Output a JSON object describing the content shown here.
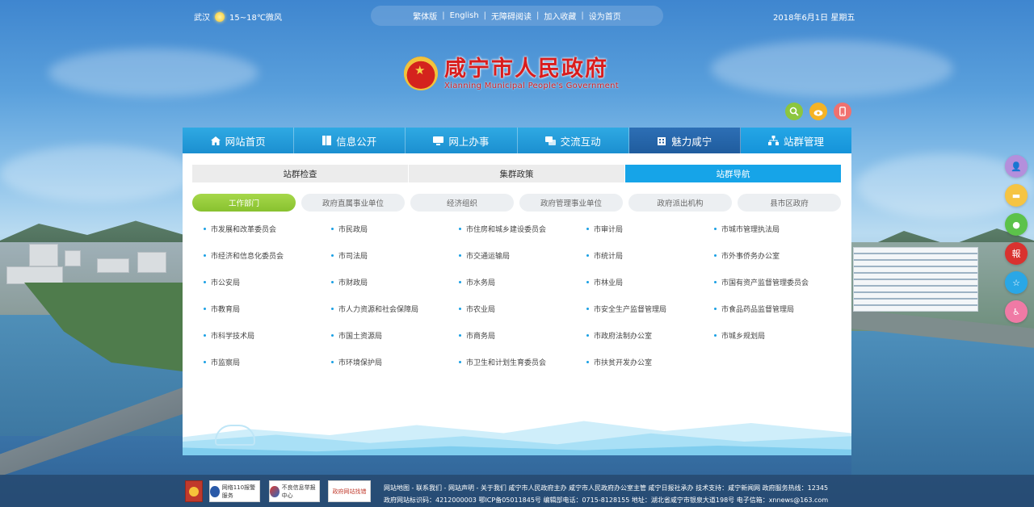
{
  "weather": {
    "city": "武汉",
    "text": "15~18℃微风",
    "icon": "sun-icon"
  },
  "topnav": {
    "items": [
      "繁体版",
      "English",
      "无障碍阅读",
      "加入收藏",
      "设为首页"
    ]
  },
  "date": "2018年6月1日 星期五",
  "logo": {
    "cn": "咸宁市人民政府",
    "en": "Xianning Municipal People's Government"
  },
  "tool_icons": [
    "search-icon",
    "weibo-icon",
    "mobile-icon"
  ],
  "mainnav": [
    {
      "label": "网站首页",
      "icon": "home-icon"
    },
    {
      "label": "信息公开",
      "icon": "book-icon"
    },
    {
      "label": "网上办事",
      "icon": "monitor-icon"
    },
    {
      "label": "交流互动",
      "icon": "chat-icon"
    },
    {
      "label": "魅力咸宁",
      "icon": "building-icon"
    },
    {
      "label": "站群管理",
      "icon": "sitemap-icon"
    }
  ],
  "tabs": [
    "站群检查",
    "集群政策",
    "站群导航"
  ],
  "active_tab": 2,
  "pills": [
    "工作部门",
    "政府直属事业单位",
    "经济组织",
    "政府管理事业单位",
    "政府派出机构",
    "县市区政府"
  ],
  "active_pill": 0,
  "links": [
    "市发展和改革委员会",
    "市民政局",
    "市住房和城乡建设委员会",
    "市审计局",
    "市城市管理执法局",
    "市经济和信息化委员会",
    "市司法局",
    "市交通运输局",
    "市统计局",
    "市外事侨务办公室",
    "市公安局",
    "市财政局",
    "市水务局",
    "市林业局",
    "市国有资产监督管理委员会",
    "市教育局",
    "市人力资源和社会保障局",
    "市农业局",
    "市安全生产监督管理局",
    "市食品药品监督管理局",
    "市科学技术局",
    "市国土资源局",
    "市商务局",
    "市政府法制办公室",
    "市城乡规划局",
    "市监察局",
    "市环境保护局",
    "市卫生和计划生育委员会",
    "市扶贫开发办公室"
  ],
  "side_buttons": [
    {
      "icon": "user-icon",
      "color": "#b48fdc"
    },
    {
      "icon": "message-icon",
      "color": "#f5c443"
    },
    {
      "icon": "wechat-icon",
      "color": "#5cc24a"
    },
    {
      "icon": "newspaper-icon",
      "color": "#d9322f"
    },
    {
      "icon": "star-icon",
      "color": "#2aa7e6"
    },
    {
      "icon": "wheelchair-icon",
      "color": "#f07aa5"
    }
  ],
  "footer": {
    "badges": [
      "网络110报警服务",
      "不良信息举报中心",
      "政府网站找错"
    ],
    "line1": "网站地图 - 联系我们 - 网站声明 - 关于我们   咸宁市人民政府主办   咸宁市人民政府办公室主管   咸宁日报社承办   技术支持：咸宁新闻网   政府服务热线：12345",
    "line2": "政府网站标识码：4212000003   鄂ICP备05011845号   编辑部电话：0715-8128155   地址：湖北省咸宁市银泉大道198号   电子信箱：xnnews@163.com"
  }
}
